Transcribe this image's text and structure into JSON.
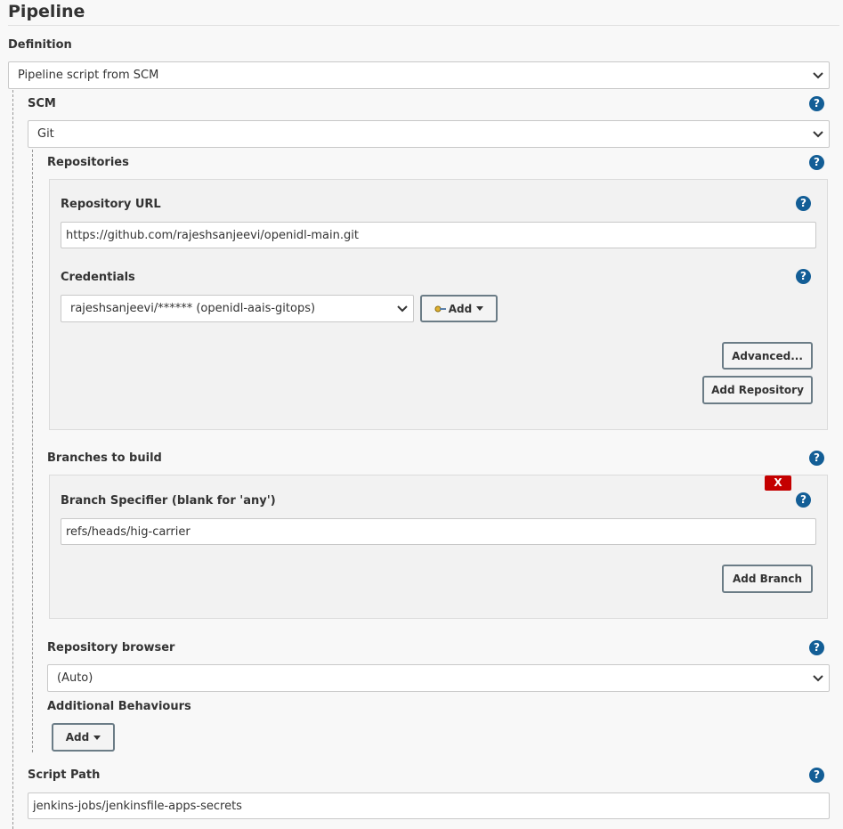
{
  "section": {
    "title": "Pipeline"
  },
  "definition": {
    "label": "Definition",
    "selected": "Pipeline script from SCM"
  },
  "scm": {
    "label": "SCM",
    "selected": "Git"
  },
  "repositories": {
    "label": "Repositories",
    "url_label": "Repository URL",
    "url_value": "https://github.com/rajeshsanjeevi/openidl-main.git",
    "credentials_label": "Credentials",
    "credentials_selected": "rajeshsanjeevi/****** (openidl-aais-gitops)",
    "add_label": "Add",
    "advanced_label": "Advanced...",
    "add_repository_label": "Add Repository"
  },
  "branches": {
    "label": "Branches to build",
    "delete_label": "X",
    "specifier_label": "Branch Specifier (blank for 'any')",
    "specifier_value": "refs/heads/hig-carrier",
    "add_branch_label": "Add Branch"
  },
  "browser": {
    "label": "Repository browser",
    "selected": "(Auto)"
  },
  "behaviours": {
    "label": "Additional Behaviours",
    "add_label": "Add"
  },
  "script_path": {
    "label": "Script Path",
    "value": "jenkins-jobs/jenkinsfile-apps-secrets"
  },
  "help": {
    "glyph": "?"
  },
  "colors": {
    "help": "#135e96",
    "delete": "#c40000",
    "button_border": "#6b7c86"
  }
}
